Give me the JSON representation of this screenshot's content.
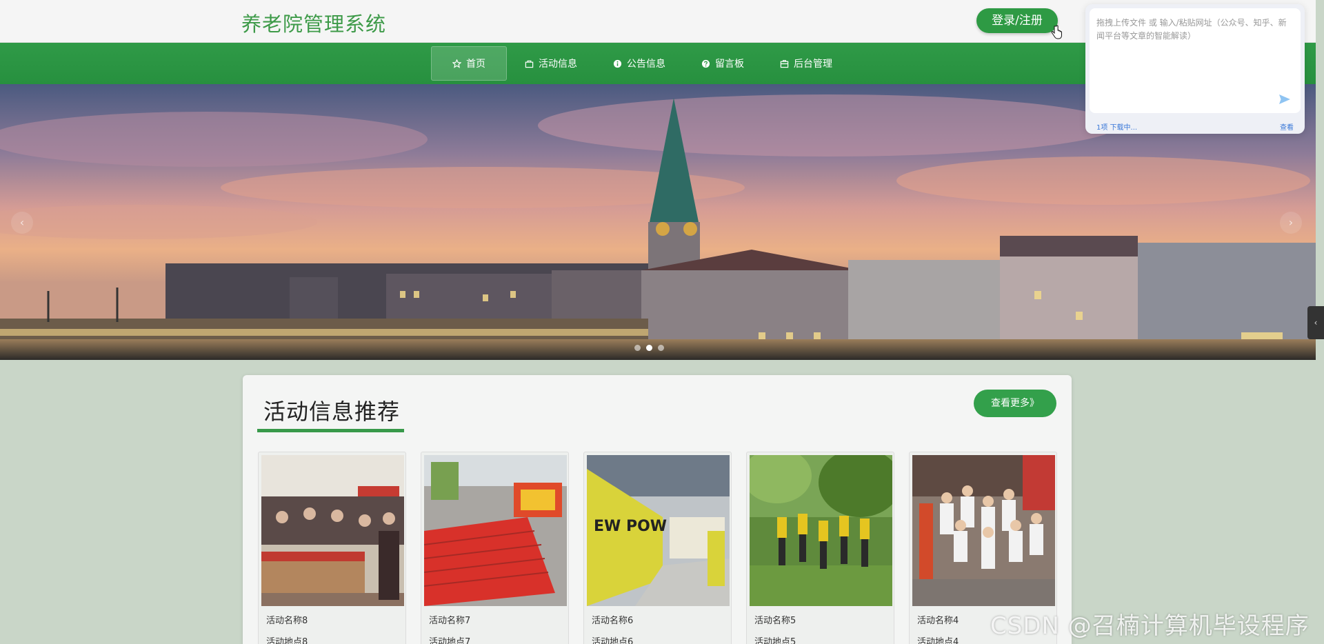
{
  "header": {
    "site_title": "养老院管理系统",
    "login_label": "登录/注册"
  },
  "nav": {
    "items": [
      {
        "label": "首页",
        "icon": "star-icon",
        "active": true
      },
      {
        "label": "活动信息",
        "icon": "bag-icon",
        "active": false
      },
      {
        "label": "公告信息",
        "icon": "info-icon",
        "active": false
      },
      {
        "label": "留言板",
        "icon": "help-icon",
        "active": false
      },
      {
        "label": "后台管理",
        "icon": "briefcase-icon",
        "active": false
      }
    ]
  },
  "banner": {
    "prev_label": "‹",
    "next_label": "›",
    "slide_count": 3,
    "active_slide": 2
  },
  "ai_panel": {
    "placeholder": "拖拽上传文件 或 输入/粘贴网址（公众号、知乎、新闻平台等文章的智能解读）",
    "status": "1项 下载中...",
    "view_label": "查看"
  },
  "side_tab": {
    "label": "‹"
  },
  "activities": {
    "title": "活动信息推荐",
    "more_label": "查看更多》",
    "items": [
      {
        "name": "活动名称8",
        "location": "活动地点8"
      },
      {
        "name": "活动名称7",
        "location": "活动地点7"
      },
      {
        "name": "活动名称6",
        "location": "活动地点6"
      },
      {
        "name": "活动名称5",
        "location": "活动地点5"
      },
      {
        "name": "活动名称4",
        "location": "活动地点4"
      }
    ]
  },
  "watermark": "CSDN @召楠计算机毕设程序",
  "colors": {
    "brand_green": "#2e9a44",
    "title_green": "#3d9a48",
    "nav_green": "#2f9a47"
  }
}
